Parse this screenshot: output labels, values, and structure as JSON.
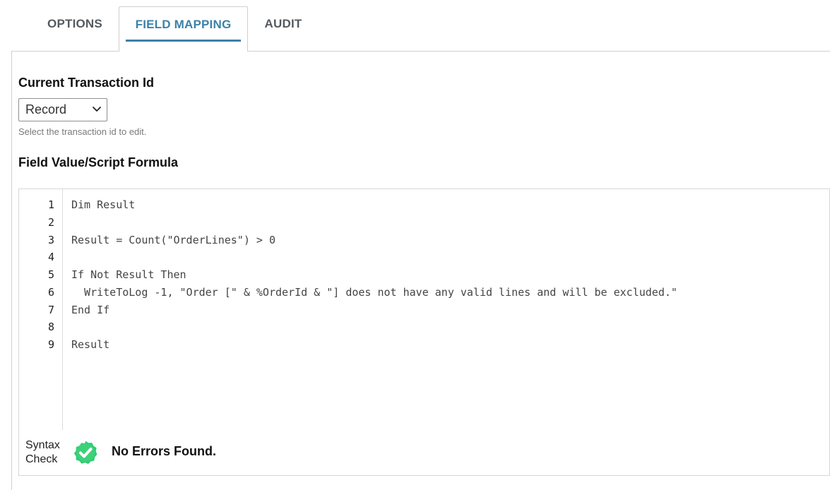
{
  "tabs": [
    {
      "label": "OPTIONS",
      "active": false
    },
    {
      "label": "FIELD MAPPING",
      "active": true
    },
    {
      "label": "AUDIT",
      "active": false
    }
  ],
  "transaction": {
    "label": "Current Transaction Id",
    "selected": "Record",
    "help": "Select the transaction id to edit."
  },
  "formula": {
    "label": "Field Value/Script Formula",
    "lines": [
      {
        "n": "1",
        "code": "Dim Result"
      },
      {
        "n": "2",
        "code": ""
      },
      {
        "n": "3",
        "code": "Result = Count(\"OrderLines\") > 0"
      },
      {
        "n": "4",
        "code": ""
      },
      {
        "n": "5",
        "code": "If Not Result Then"
      },
      {
        "n": "6",
        "code": "  WriteToLog -1, \"Order [\" & %OrderId & \"] does not have any valid lines and will be excluded.\""
      },
      {
        "n": "7",
        "code": "End If"
      },
      {
        "n": "8",
        "code": ""
      },
      {
        "n": "9",
        "code": "Result"
      }
    ]
  },
  "syntax": {
    "label_line1": "Syntax",
    "label_line2": "Check",
    "icon": "check-circle-icon",
    "message": "No Errors Found.",
    "status_color": "#2ecc71"
  },
  "colors": {
    "accent": "#3b82a8",
    "tab_text": "#555a5f"
  }
}
